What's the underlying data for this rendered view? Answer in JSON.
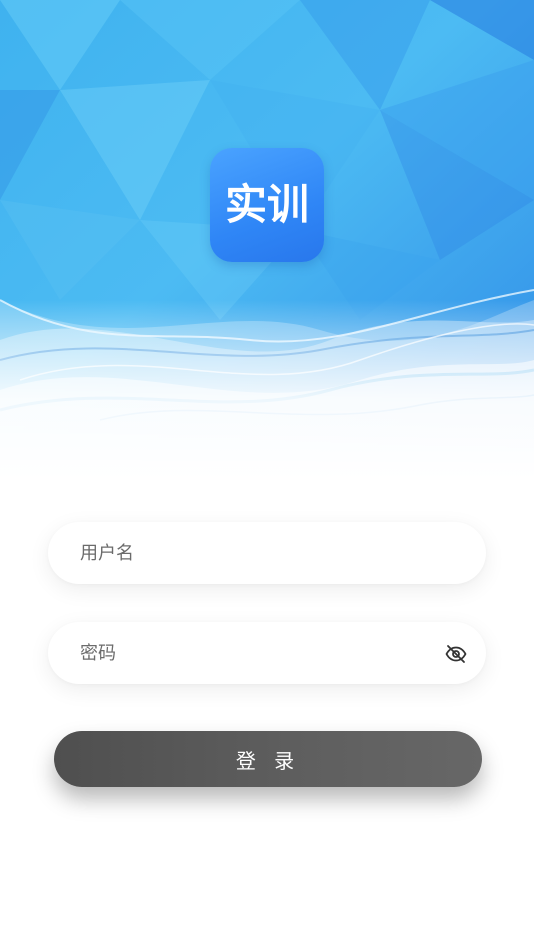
{
  "app": {
    "logo_text": "实训"
  },
  "form": {
    "username": {
      "placeholder": "用户名",
      "value": ""
    },
    "password": {
      "placeholder": "密码",
      "value": ""
    },
    "password_visibility_icon": "eye-off-icon",
    "login_label": "登 录"
  },
  "colors": {
    "hero_blue_light": "#5ec3f6",
    "hero_blue_dark": "#2f86ee",
    "logo_blue": "#3b90f8",
    "button_gray": "#5a5a5a",
    "placeholder_gray": "#6b6b6b"
  }
}
